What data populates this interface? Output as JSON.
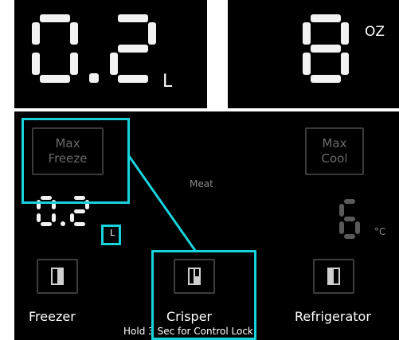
{
  "top_left_display": {
    "value": "0.2",
    "unit": "L"
  },
  "top_right_display": {
    "value": "8",
    "unit": "OZ"
  },
  "control_panel": {
    "max_freeze_button": {
      "line1": "Max",
      "line2": "Freeze"
    },
    "max_cool_button": {
      "line1": "Max",
      "line2": "Cool"
    },
    "meat_label": "Meat",
    "volume_readout": {
      "value": "0.2",
      "unit": "L"
    },
    "temperature_readout": {
      "value": "6",
      "unit": "°C"
    },
    "modes": [
      {
        "label": "Freezer",
        "icon": "freezer-door-icon"
      },
      {
        "label": "Crisper",
        "icon": "crisper-drawer-icon"
      },
      {
        "label": "Refrigerator",
        "icon": "refrigerator-door-icon"
      }
    ],
    "lock_hint": "Hold 3 Sec for Control Lock"
  },
  "colors": {
    "highlight": "#19d3dc",
    "segment_bright": "#f2f2f2",
    "segment_dim": "#5a5a5a",
    "panel_background": "#000000"
  }
}
